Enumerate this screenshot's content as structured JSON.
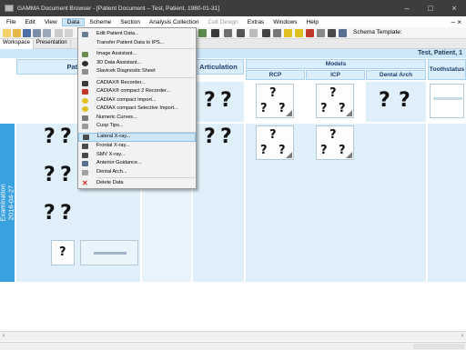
{
  "window": {
    "title": "GAMMA Document Browser - [Patient Document – Test, Patient, 1980-01-31]",
    "controls": [
      "–",
      "□",
      "×"
    ]
  },
  "menubar": {
    "items": [
      {
        "label": "File",
        "state": "normal"
      },
      {
        "label": "Edit",
        "state": "normal"
      },
      {
        "label": "View",
        "state": "normal"
      },
      {
        "label": "Data",
        "state": "open"
      },
      {
        "label": "Scheme",
        "state": "normal"
      },
      {
        "label": "Section",
        "state": "normal"
      },
      {
        "label": "Analysis Collection",
        "state": "normal"
      },
      {
        "label": "Cell Design",
        "state": "disabled"
      },
      {
        "label": "Extras",
        "state": "normal"
      },
      {
        "label": "Windows",
        "state": "normal"
      },
      {
        "label": "Help",
        "state": "normal"
      }
    ],
    "doc_close": "– ×"
  },
  "toolbar": {
    "template_label": "Schema Template:"
  },
  "tabs": {
    "items": [
      "Workspace",
      "Presentation"
    ]
  },
  "workspace": {
    "patient_name": "Test, Patient, 1",
    "columns": {
      "patient": "Patient",
      "articulation": "Articulation",
      "models": "Models",
      "rcp": "RCP",
      "icp": "ICP",
      "dental_arch": "Dental Arch",
      "toothstatus": "Toothstatus"
    },
    "row": {
      "line1": "Examination",
      "line2": "2016-04-27"
    }
  },
  "data_menu": {
    "items": [
      {
        "label": "Edit Patient Data...",
        "icon": "edit-patient-icon",
        "color": "#6a7f95"
      },
      {
        "label": "Transfer Patient Data to IPS...",
        "icon": "",
        "color": ""
      },
      {
        "sep": true
      },
      {
        "label": "Image Assistant...",
        "icon": "image-assistant-icon",
        "color": "#6b8e4e"
      },
      {
        "label": "3D Data Assistant...",
        "icon": "3d-data-icon",
        "color": "#2e2e2e"
      },
      {
        "label": "Slavicek Diagnostic Sheet",
        "icon": "diagnostic-sheet-icon",
        "color": "#8e8e8e"
      },
      {
        "sep": true
      },
      {
        "label": "CADIAX® Recorder...",
        "icon": "cadiax-recorder-icon",
        "color": "#3b3b3b"
      },
      {
        "label": "CADIAX® compact 2 Recorder...",
        "icon": "cadiax-compact-2-icon",
        "color": "#c0392b"
      },
      {
        "label": "CADIAX compact Import...",
        "icon": "cadiax-import-icon",
        "color": "#e0c020"
      },
      {
        "label": "CADIAX compact Selective Import...",
        "icon": "cadiax-selective-import-icon",
        "color": "#e0c020"
      },
      {
        "label": "Numeric Curves...",
        "icon": "numeric-curves-icon",
        "color": "#7a7a7a"
      },
      {
        "label": "Cusp Tips...",
        "icon": "cusp-tips-icon",
        "color": "#9a9a9a"
      },
      {
        "sep": true
      },
      {
        "label": "Lateral X-ray...",
        "icon": "lateral-xray-icon",
        "color": "#4a4a4a"
      },
      {
        "label": "Frontal X-ray...",
        "icon": "frontal-xray-icon",
        "color": "#4a4a4a"
      },
      {
        "label": "SMV X-ray...",
        "icon": "smv-xray-icon",
        "color": "#4a4a4a"
      },
      {
        "label": "Anterior Guidance...",
        "icon": "anterior-guidance-icon",
        "color": "#5a7090"
      },
      {
        "label": "Dental Arch...",
        "icon": "dental-arch-icon",
        "color": "#a0a0a0"
      },
      {
        "sep": true
      },
      {
        "label": "Delete Data",
        "icon": "delete-icon",
        "color": "#d32f2f"
      }
    ],
    "highlighted_index": 14
  },
  "colors": {
    "titlebar": "#3d3d3d",
    "column_header": "#daeefb",
    "row_header": "#3aa1df",
    "cell_background": "#e0f0fb",
    "highlight": "#cde6f7"
  }
}
